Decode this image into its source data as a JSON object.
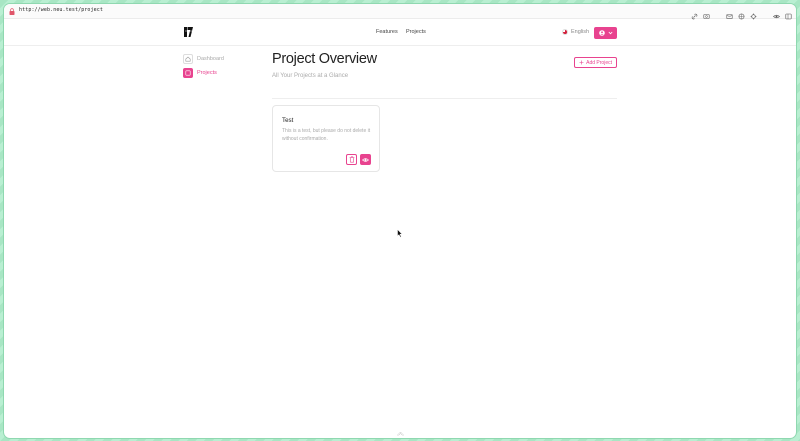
{
  "browser": {
    "url": "http://web.neu.test/project"
  },
  "nav": {
    "links": [
      "Features",
      "Projects"
    ],
    "language": "English"
  },
  "sidebar": {
    "items": [
      {
        "label": "Dashboard",
        "icon": "home-icon",
        "active": false
      },
      {
        "label": "Projects",
        "icon": "grid-icon",
        "active": true
      }
    ]
  },
  "main": {
    "title": "Project Overview",
    "subtitle": "All Your Projects at a Glance",
    "add_button": "Add Project"
  },
  "projects": [
    {
      "name": "Test",
      "description": "This is a test, but please do not delete it without confirmation."
    }
  ],
  "colors": {
    "accent": "#e8438f",
    "background": "#ffffff",
    "frame": "#a8e6c4"
  }
}
